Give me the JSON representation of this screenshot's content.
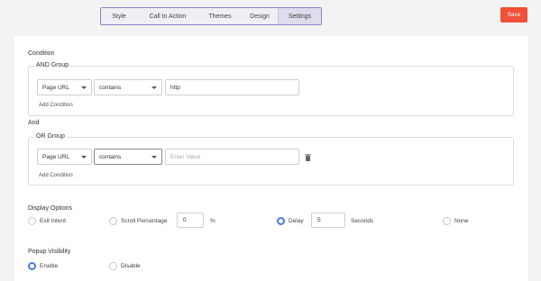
{
  "tabs": [
    {
      "label": "Style"
    },
    {
      "label": "Call to Action"
    },
    {
      "label": "Themes"
    },
    {
      "label": "Design"
    },
    {
      "label": "Settings",
      "active": true
    }
  ],
  "save_label": "Save",
  "condition": {
    "title": "Condition",
    "and_group": {
      "title": "AND Group",
      "field": "Page URL",
      "operator": "contains",
      "value": "http",
      "add_label": "Add Condition"
    },
    "joiner": "And",
    "or_group": {
      "title": "OR Group",
      "field": "Page URL",
      "operator": "contains",
      "value_placeholder": "Enter Value",
      "add_label": "Add Condition"
    }
  },
  "display_options": {
    "title": "Display Options",
    "exit_intent": "Exit Intent",
    "scroll_percentage": "Scroll Percentage",
    "scroll_value": "0",
    "scroll_unit": "%",
    "delay": "Delay",
    "delay_value": "5",
    "delay_unit": "Seconds",
    "none": "None",
    "selected": "Delay"
  },
  "popup_visibility": {
    "title": "Popup Visibility",
    "enable": "Enable",
    "disable": "Disable",
    "selected": "Enable"
  },
  "colors": {
    "accent": "#4a7ad6",
    "save": "#f0513a",
    "tab_border": "#8d87c9"
  }
}
